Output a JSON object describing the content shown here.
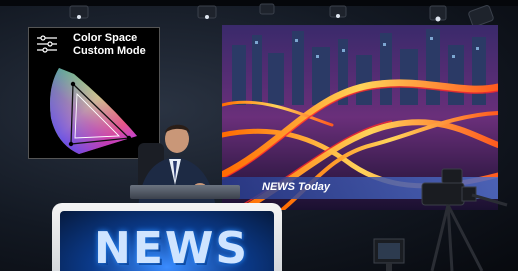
{
  "color_panel": {
    "title_line1": "Color Space",
    "title_line2": "Custom Mode"
  },
  "screen": {
    "caption": "NEWS Today"
  },
  "monitor": {
    "word": "NEWS"
  },
  "colors": {
    "screen_bar": "#3c5ab4",
    "monitor_glow": "#2a8cff"
  }
}
